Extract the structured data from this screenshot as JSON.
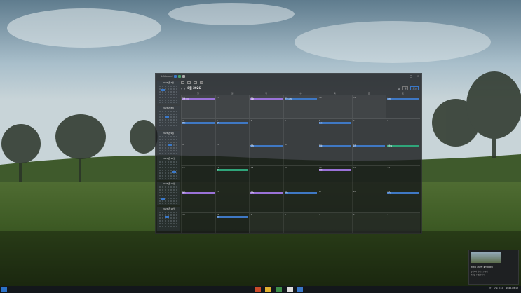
{
  "window": {
    "title": "Lifeboard"
  },
  "calendar": {
    "month": "8월 2026",
    "weekdays": [
      "일",
      "월",
      "화",
      "수",
      "목",
      "금",
      "토"
    ],
    "view": "월",
    "today": "오늘",
    "weeks": [
      {
        "days": [
          "26",
          "27",
          "28",
          "29",
          "30",
          "31",
          "1"
        ],
        "events": [
          {
            "col": 0,
            "text": "가족 여행",
            "color": "#9a72d8"
          },
          {
            "col": 2,
            "text": "회의",
            "color": "#9a72d8"
          },
          {
            "col": 3,
            "text": "업무 미팅",
            "color": "#3f78c4"
          },
          {
            "col": 6,
            "text": "점검",
            "color": "#3f78c4"
          }
        ]
      },
      {
        "days": [
          "2",
          "3",
          "4",
          "5",
          "6",
          "7",
          "8"
        ],
        "events": [
          {
            "col": 0,
            "text": "운동",
            "color": "#3f78c4"
          },
          {
            "col": 1,
            "text": "회의",
            "color": "#3f78c4"
          },
          {
            "col": 4,
            "text": "보고",
            "color": "#3f78c4"
          }
        ]
      },
      {
        "days": [
          "9",
          "10",
          "11",
          "12",
          "13",
          "14",
          "15"
        ],
        "events": [
          {
            "col": 2,
            "text": "일정",
            "color": "#3f78c4"
          },
          {
            "col": 4,
            "text": "회의",
            "color": "#3f78c4"
          },
          {
            "col": 5,
            "text": "미팅",
            "color": "#3f78c4"
          },
          {
            "col": 6,
            "text": "광복절",
            "color": "#2fa57a"
          }
        ]
      },
      {
        "days": [
          "16",
          "17",
          "18",
          "19",
          "20",
          "21",
          "22"
        ],
        "events": [
          {
            "col": 1,
            "text": "약속",
            "color": "#2fa57a"
          },
          {
            "col": 4,
            "text": "모임",
            "color": "#9a72d8"
          }
        ]
      },
      {
        "days": [
          "23",
          "24",
          "25",
          "26",
          "27",
          "28",
          "29"
        ],
        "events": [
          {
            "col": 0,
            "text": "행사",
            "color": "#9a72d8"
          },
          {
            "col": 2,
            "text": "회의",
            "color": "#9a72d8"
          },
          {
            "col": 3,
            "text": "미팅",
            "color": "#3f78c4"
          },
          {
            "col": 6,
            "text": "정리",
            "color": "#3f78c4"
          }
        ]
      },
      {
        "days": [
          "30",
          "31",
          "1",
          "2",
          "3",
          "4",
          "5"
        ],
        "events": [
          {
            "col": 1,
            "text": "마감",
            "color": "#3f78c4"
          }
        ]
      }
    ]
  },
  "sidebar": {
    "months": [
      "2026년 7월",
      "2026년 8월",
      "2026년 9월",
      "2026년 10월",
      "2026년 11월",
      "2026년 12월"
    ]
  },
  "notification": {
    "title": "캡처된 화면을 확인하세요",
    "line1": "클릭하여 캡처 도구에서",
    "line2": "편집할 수 있습니다"
  },
  "taskbar": {
    "time": "오후 3:10",
    "date": "2026-08-12",
    "lang": "한"
  },
  "colors": {
    "accent": "#3a78c8"
  }
}
